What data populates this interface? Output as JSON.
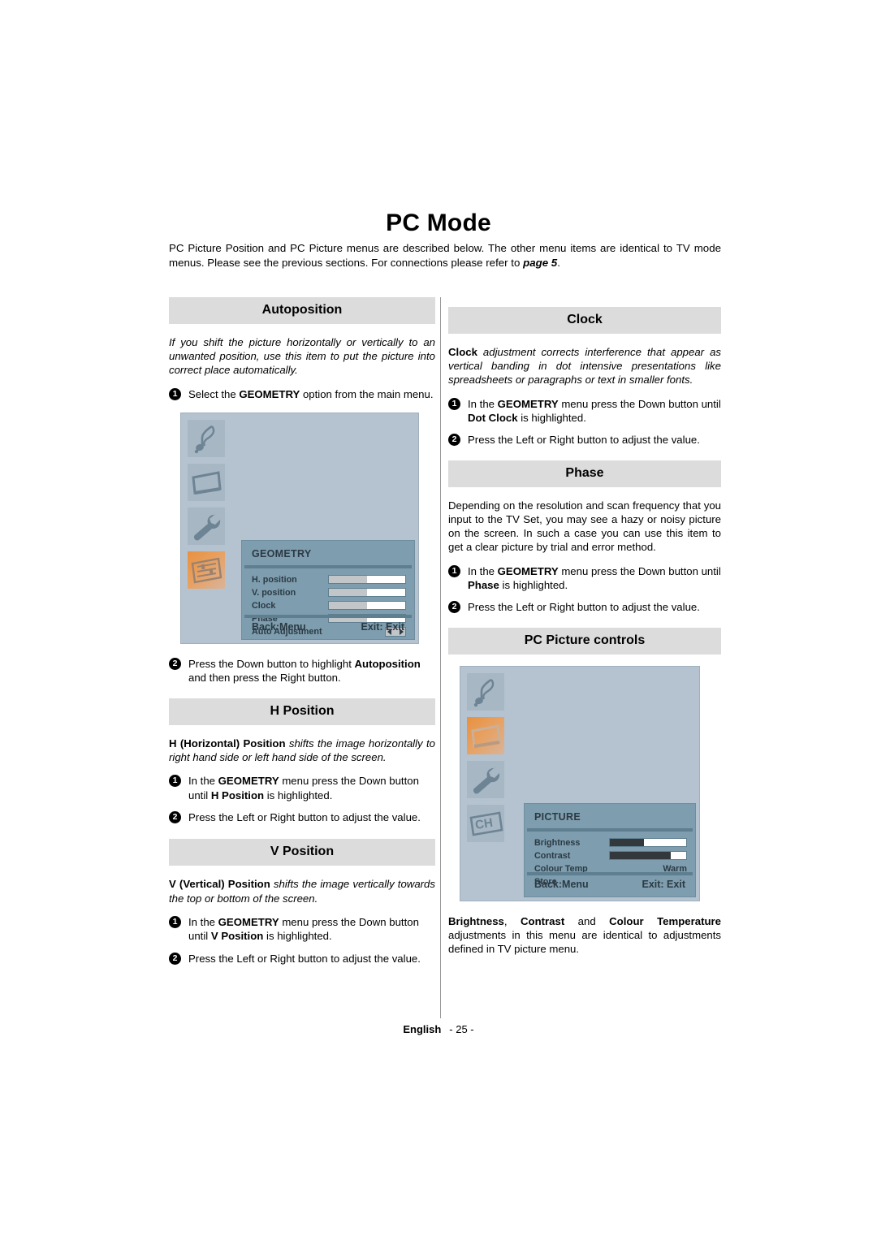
{
  "page": {
    "title": "PC Mode",
    "intro": {
      "text_before": "PC Picture Position and PC Picture menus are described below. The other menu items are identical to TV mode menus. Please see the previous sections. For connections please refer to ",
      "emphasis": "page 5",
      "text_after": "."
    },
    "footer": {
      "language": "English",
      "page_number": "- 25 -"
    }
  },
  "left_column": {
    "autoposition": {
      "heading": "Autoposition",
      "body": "If you shift the picture horizontally or vertically to an unwanted position, use this item to put the picture into correct place automatically.",
      "step1": {
        "num": "1",
        "before": "Select the ",
        "bold": "GEOMETRY",
        "after": " option from the main menu."
      },
      "step2": {
        "num": "2",
        "before": "Press the Down button to highlight ",
        "bold": "Autoposition",
        "after": " and then press the Right button."
      }
    },
    "h_position": {
      "heading": "H Position",
      "body_bold": "H (Horizontal) Position",
      "body_italic": " shifts the image horizontally to right hand side or left hand side of the screen.",
      "step1": {
        "num": "1",
        "before": "In the ",
        "bold": "GEOMETRY",
        "mid": " menu press the Down button until ",
        "bold2": "H Position",
        "after": " is highlighted."
      },
      "step2": {
        "num": "2",
        "text": "Press the Left or Right button to adjust the value."
      }
    },
    "v_position": {
      "heading": "V Position",
      "body_bold": "V (Vertical) Position",
      "body_italic": " shifts the image vertically towards the top or bottom of the screen.",
      "step1": {
        "num": "1",
        "before": "In the ",
        "bold": "GEOMETRY",
        "mid": " menu press the Down button until ",
        "bold2": "V Position",
        "after": " is highlighted."
      },
      "step2": {
        "num": "2",
        "text": "Press the Left or Right button to adjust the value."
      }
    }
  },
  "right_column": {
    "clock": {
      "heading": "Clock",
      "body_bold": "Clock",
      "body_italic": " adjustment corrects interference that appear as vertical banding in dot intensive presentations like spreadsheets or paragraphs or text in smaller fonts.",
      "step1": {
        "num": "1",
        "before": "In the ",
        "bold": "GEOMETRY",
        "mid": " menu press the Down button until ",
        "bold2": "Dot Clock",
        "after": " is highlighted."
      },
      "step2": {
        "num": "2",
        "text": "Press the Left or Right button to adjust the value."
      }
    },
    "phase": {
      "heading": "Phase",
      "body": "Depending on the resolution and scan frequency that you input to the TV Set, you may see a hazy or noisy picture on the screen. In such a case you can use this item to get a clear picture by trial and error method.",
      "step1": {
        "num": "1",
        "before": "In the ",
        "bold": "GEOMETRY",
        "mid": " menu press the Down button until ",
        "bold2": "Phase",
        "after": " is highlighted."
      },
      "step2": {
        "num": "2",
        "text": "Press the Left or Right button to adjust the value."
      }
    },
    "pc_picture_controls": {
      "heading": "PC Picture controls",
      "note": {
        "b1": "Brightness",
        "sep1": ", ",
        "b2": "Contrast",
        "sep2": " and ",
        "b3": "Colour Temperature",
        "tail": " adjustments in this menu are identical to adjustments defined in TV picture menu."
      }
    }
  },
  "osd_geometry": {
    "panel_title": "GEOMETRY",
    "icons": [
      {
        "name": "music-note-icon",
        "selected": false
      },
      {
        "name": "picture-screen-icon",
        "selected": false
      },
      {
        "name": "wrench-icon",
        "selected": false
      },
      {
        "name": "geometry-sliders-icon",
        "selected": true
      }
    ],
    "rows": [
      {
        "label": "H. position",
        "control": "slider",
        "value_pct": 50
      },
      {
        "label": "V. position",
        "control": "slider",
        "value_pct": 50
      },
      {
        "label": "Clock",
        "control": "slider",
        "value_pct": 50
      },
      {
        "label": "Phase",
        "control": "slider",
        "value_pct": 50
      },
      {
        "label": "Auto Adjustment",
        "control": "arrows",
        "value_pct": 0
      }
    ],
    "footer_left": "Back:Menu",
    "footer_right": "Exit: Exit"
  },
  "osd_picture": {
    "panel_title": "PICTURE",
    "icons": [
      {
        "name": "music-note-icon",
        "selected": false
      },
      {
        "name": "picture-screen-icon",
        "selected": true
      },
      {
        "name": "wrench-icon",
        "selected": false
      },
      {
        "name": "channel-ch-icon",
        "selected": false
      }
    ],
    "rows": [
      {
        "label": "Brightness",
        "control": "slider-dark",
        "value_pct": 45,
        "value_text": ""
      },
      {
        "label": "Contrast",
        "control": "slider-dark",
        "value_pct": 80,
        "value_text": ""
      },
      {
        "label": "Colour Temp",
        "control": "text",
        "value_pct": 0,
        "value_text": "Warm"
      },
      {
        "label": "Store",
        "control": "none",
        "value_pct": 0,
        "value_text": ""
      }
    ],
    "footer_left": "Back:Menu",
    "footer_right": "Exit: Exit"
  },
  "colors": {
    "section_header_bg": "#dcdcdc",
    "osd_background": "#b4c3cf",
    "osd_panel": "#7e9dae",
    "osd_rule": "#5e7f90",
    "osd_selected_icon": "#e8913f",
    "slider_fill_light": "#c3c6c9",
    "slider_fill_dark": "#32383c"
  }
}
